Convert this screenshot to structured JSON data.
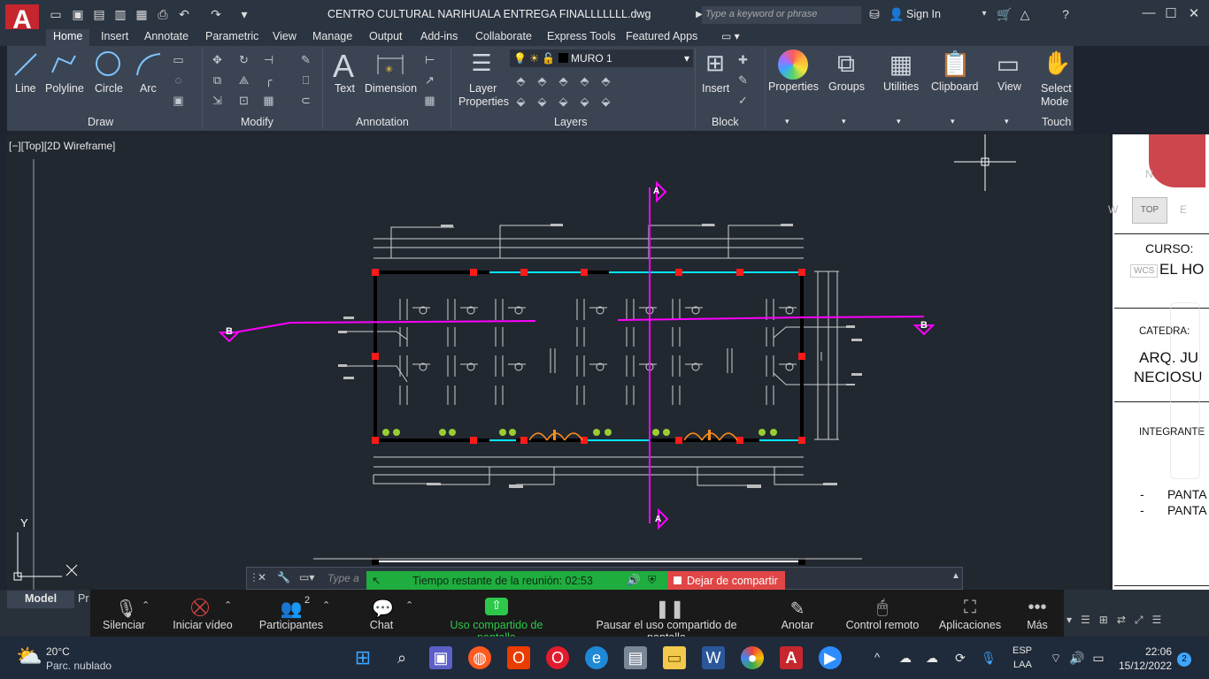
{
  "title_bar": {
    "logo": "A",
    "document_title": "CENTRO CULTURAL NARIHUALA ENTREGA FINALLLLLLL.dwg",
    "search_placeholder": "Type a keyword or phrase",
    "sign_in": "Sign In"
  },
  "ribbon_tabs": [
    "Home",
    "Insert",
    "Annotate",
    "Parametric",
    "View",
    "Manage",
    "Output",
    "Add-ins",
    "Collaborate",
    "Express Tools",
    "Featured Apps"
  ],
  "ribbon": {
    "draw_tools": [
      "Line",
      "Polyline",
      "Circle",
      "Arc"
    ],
    "panels": {
      "draw": "Draw",
      "modify": "Modify",
      "annotation": "Annotation",
      "layers": "Layers",
      "block": "Block",
      "touch": "Touch"
    },
    "annotation_tools": [
      "Text",
      "Dimension"
    ],
    "layer_properties": [
      "Layer",
      "Properties"
    ],
    "current_layer": "MURO 1",
    "insert": "Insert",
    "big_buttons": [
      "Properties",
      "Groups",
      "Utilities",
      "Clipboard",
      "View"
    ],
    "select_mode": [
      "Select",
      "Mode"
    ]
  },
  "viewport": {
    "label": "[−][Top][2D Wireframe]",
    "axis_y": "Y",
    "viewcube_top": "TOP",
    "viewcube_n": "N",
    "viewcube_w": "W",
    "viewcube_e": "E",
    "wcs": "WCS"
  },
  "drawing": {
    "section_marker_b": "B",
    "section_marker_a": "A"
  },
  "titleblock": {
    "curso_label": "CURSO:",
    "curso_value": "EL HO",
    "catedra_label": "CATEDRA:",
    "catedra_line1": "ARQ. JU",
    "catedra_line2": "NECIOSU",
    "integrantes_label": "INTEGRANTE",
    "item1": "PANTA",
    "item2": "PANTA",
    "bullet": "-"
  },
  "command_line": {
    "placeholder": "Type a"
  },
  "layout_tabs": [
    "Model",
    "Pr"
  ],
  "zoom": {
    "timer": "Tiempo restante de la reunión: 02:53",
    "stop_share": "Dejar de compartir",
    "participants_count": "2",
    "controls": [
      "Silenciar",
      "Iniciar vídeo",
      "Participantes",
      "Chat",
      "Uso compartido de pantalla",
      "Pausar el uso compartido de pantalla",
      "Anotar",
      "Control remoto",
      "Aplicaciones",
      "Más"
    ],
    "share_color": "#2dc84b"
  },
  "taskbar": {
    "weather_temp": "20°C",
    "weather_desc": "Parc. nublado",
    "lang1": "ESP",
    "lang2": "LAA",
    "time": "22:06",
    "date": "15/12/2022",
    "notifications": "2"
  },
  "colors": {
    "accent_red": "#c6262e",
    "magenta": "#ff00ff",
    "cyan": "#00e5ff"
  }
}
